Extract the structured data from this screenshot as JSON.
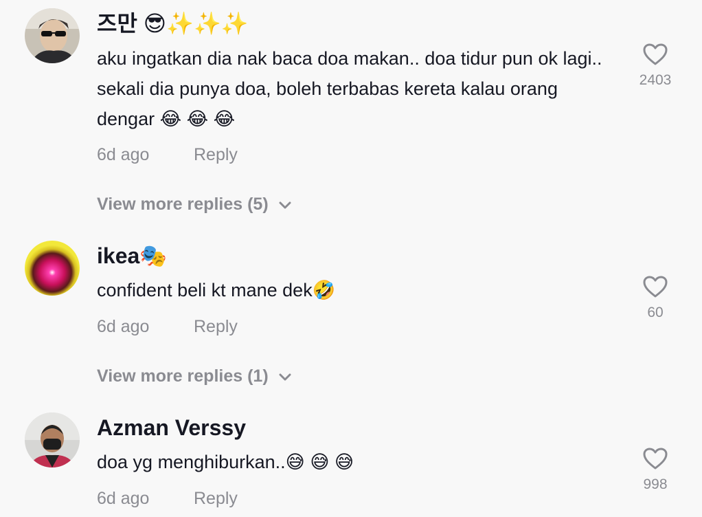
{
  "comments": [
    {
      "username": "즈만",
      "username_emoji": "😎✨✨✨",
      "text": "aku ingatkan dia nak baca doa makan.. doa tidur pun ok lagi.. sekali dia punya doa, boleh terbabas kereta kalau orang dengar 😂 😂 😂",
      "time": "6d ago",
      "reply_label": "Reply",
      "like_count": "2403",
      "more_replies": "View more replies (5)"
    },
    {
      "username": "ikea",
      "username_emoji": "🎭",
      "text": "confident beli kt mane dek🤣",
      "time": "6d ago",
      "reply_label": "Reply",
      "like_count": "60",
      "more_replies": "View more replies (1)"
    },
    {
      "username": "Azman Verssy",
      "username_emoji": "",
      "text": "doa yg menghiburkan..😅 😅 😅",
      "time": "6d ago",
      "reply_label": "Reply",
      "like_count": "998"
    }
  ],
  "icons": {
    "like": "heart-outline-icon",
    "expand": "chevron-down-icon"
  },
  "colors": {
    "background": "#f8f8f8",
    "username": "#161823",
    "secondary": "#8a8b91"
  }
}
